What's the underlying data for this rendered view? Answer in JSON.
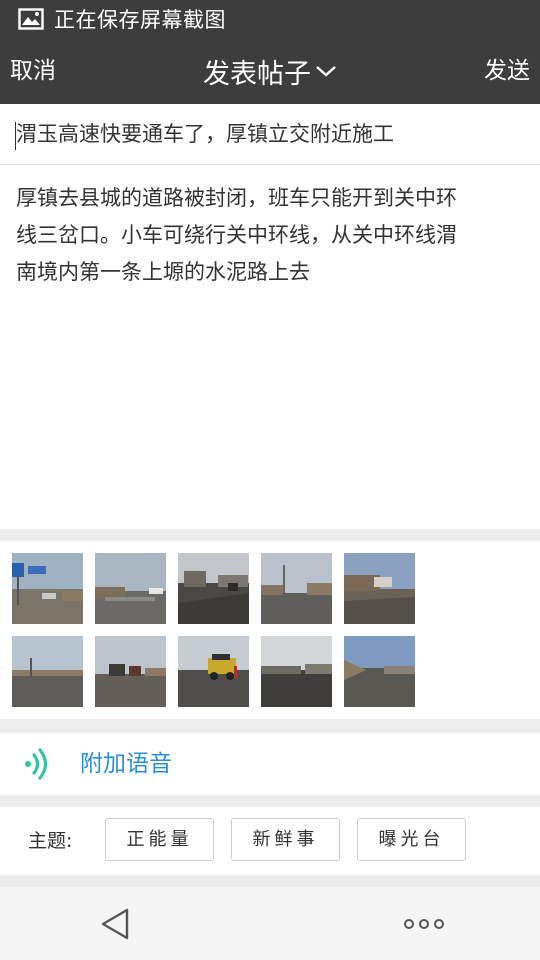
{
  "status_bar": {
    "text": "正在保存屏幕截图",
    "icon": "image-icon"
  },
  "header": {
    "cancel_label": "取消",
    "title": "发表帖子",
    "send_label": "发送",
    "background": "#3d3d3d"
  },
  "post": {
    "subject": "渭玉高速快要通车了，厚镇立交附近施工",
    "body_lines": [
      "厚镇去县城的道路被封闭，班车只能开到关中环",
      "线三岔口。小车可绕行关中环线，从关中环线渭",
      "南境内第一条上塬的水泥路上去"
    ]
  },
  "photos": {
    "count": 10,
    "items": [
      "road-photo",
      "road-photo",
      "road-photo",
      "road-photo",
      "road-photo",
      "road-photo",
      "road-photo",
      "road-photo",
      "road-photo",
      "road-photo"
    ]
  },
  "voice": {
    "label": "附加语音",
    "icon": "sound-wave-icon",
    "color": "#2b8fd6"
  },
  "topics": {
    "label": "主题:",
    "options": [
      "正能量",
      "新鲜事",
      "曝光台"
    ]
  },
  "nav": {
    "back_icon": "back-triangle-icon",
    "more_icon": "more-dots-icon"
  }
}
